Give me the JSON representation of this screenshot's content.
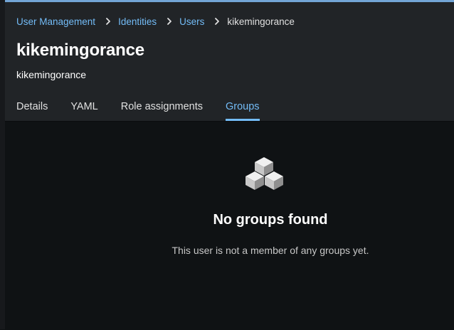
{
  "breadcrumb": {
    "items": [
      {
        "label": "User Management"
      },
      {
        "label": "Identities"
      },
      {
        "label": "Users"
      }
    ],
    "current": "kikemingorance"
  },
  "page": {
    "title": "kikemingorance",
    "subtitle": "kikemingorance"
  },
  "tabs": [
    {
      "label": "Details",
      "active": false
    },
    {
      "label": "YAML",
      "active": false
    },
    {
      "label": "Role assignments",
      "active": false
    },
    {
      "label": "Groups",
      "active": true
    }
  ],
  "empty_state": {
    "icon": "cubes-icon",
    "title": "No groups found",
    "body": "This user is not a member of any groups yet."
  },
  "colors": {
    "accent": "#73bcf7",
    "header_bg": "#212427",
    "content_bg": "#0f1214"
  }
}
